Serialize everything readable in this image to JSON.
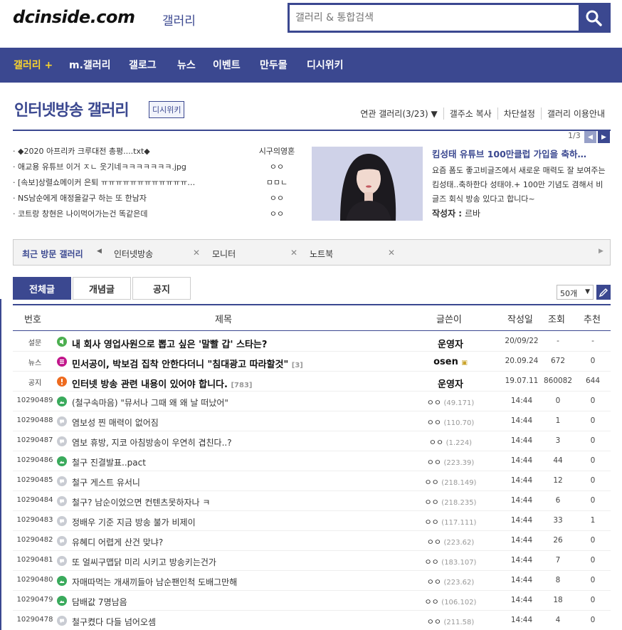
{
  "header": {
    "logo": "dcinside.com",
    "logo_sub": "갤러리",
    "search_placeholder": "갤러리 & 통합검색"
  },
  "nav": [
    "갤러리 +",
    "m.갤러리",
    "갤로그",
    "뉴스",
    "이벤트",
    "만두몰",
    "디시위키"
  ],
  "gallery": {
    "title": "인터넷방송 갤러리",
    "wiki_tag": "디시위키",
    "tools": [
      "연관 갤러리(3/23) ▼",
      "갤주소 복사",
      "차단설정",
      "갤러리 이용안내"
    ]
  },
  "concept_list": [
    {
      "title": "◆2020 아프리카 크루대전 총평....txt◆",
      "author": "시구의영혼"
    },
    {
      "title": "애교용 유튜브 이거 ㅈㄴ 웃기네ㅋㅋㅋㅋㅋㅋㅋ.jpg",
      "author": "ㅇㅇ"
    },
    {
      "title": "[속보]상렬쇼메이커 은퇴 ㅠㅠㅠㅠㅠㅠㅠㅠㅠㅠㅠㅠ…",
      "author": "ㅁㅁㄴ"
    },
    {
      "title": "NS남순에게 애정을갈구 하는 또 한남자",
      "author": "ㅇㅇ"
    },
    {
      "title": "코트랑 창현은 나이먹어가는건 똑같은데",
      "author": "ㅇㅇ"
    }
  ],
  "featured": {
    "pager": "1/3",
    "title": "킴성태 유튜브 100만클럽 가입을 축하…",
    "body": "요즘 폼도 좋고비글즈에서 새로운 매력도 잘 보여주는 킴성태..축하한다 성태야.+ 100만 기념도 겸해서 비글즈 회식 방송 있다고 합니다~",
    "writer_label": "작성자 :",
    "writer": "르바"
  },
  "recent": {
    "label": "최근 방문 갤러리",
    "items": [
      "인터넷방송",
      "모니터",
      "노트북"
    ]
  },
  "tabs": [
    "전체글",
    "개념글",
    "공지"
  ],
  "list_count": "50개",
  "table": {
    "headers": [
      "번호",
      "제목",
      "글쓴이",
      "작성일",
      "조회",
      "추천"
    ],
    "rows": [
      {
        "no": "설문",
        "icon": "survey",
        "title": "내 회사 영업사원으로 뽑고 싶은 '말빨 갑' 스타는?",
        "reply": "",
        "writer": "운영자",
        "ip": "",
        "date": "20/09/22",
        "views": "-",
        "rec": "-",
        "notice": true
      },
      {
        "no": "뉴스",
        "icon": "news",
        "title": "민서공이, 박보검 집착 안한다더니 \"침대광고 따라할것\"",
        "reply": "[3]",
        "writer": "osen",
        "ip": "",
        "date": "20.09.24",
        "views": "672",
        "rec": "0",
        "notice": true
      },
      {
        "no": "공지",
        "icon": "notice",
        "title": "인터넷 방송 관련 내용이 있어야 합니다.",
        "reply": "[783]",
        "writer": "운영자",
        "ip": "",
        "date": "19.07.11",
        "views": "860082",
        "rec": "644",
        "notice": true
      },
      {
        "no": "10290489",
        "icon": "image",
        "title": "(철구속마음) \"뮤서나 그때 왜 왜 날 떠났어\"",
        "reply": "",
        "writer": "ㅇㅇ",
        "ip": "(49.171)",
        "date": "14:44",
        "views": "0",
        "rec": "0"
      },
      {
        "no": "10290488",
        "icon": "text",
        "title": "염보성 찐 매력이 없어짐",
        "reply": "",
        "writer": "ㅇㅇ",
        "ip": "(110.70)",
        "date": "14:44",
        "views": "1",
        "rec": "0"
      },
      {
        "no": "10290487",
        "icon": "text",
        "title": "염보 휴방, 지코 아침방송이 우연히 겹친다..?",
        "reply": "",
        "writer": "ㅇㅇ",
        "ip": "(1.224)",
        "date": "14:44",
        "views": "3",
        "rec": "0"
      },
      {
        "no": "10290486",
        "icon": "image",
        "title": "철구 진결발표..pact",
        "reply": "",
        "writer": "ㅇㅇ",
        "ip": "(223.39)",
        "date": "14:44",
        "views": "44",
        "rec": "0"
      },
      {
        "no": "10290485",
        "icon": "text",
        "title": "철구 게스트 유서니",
        "reply": "",
        "writer": "ㅇㅇ",
        "ip": "(218.149)",
        "date": "14:44",
        "views": "12",
        "rec": "0"
      },
      {
        "no": "10290484",
        "icon": "text",
        "title": "철구? 남순이었으면 컨텐츠못하자나 ㅋ",
        "reply": "",
        "writer": "ㅇㅇ",
        "ip": "(218.235)",
        "date": "14:44",
        "views": "6",
        "rec": "0"
      },
      {
        "no": "10290483",
        "icon": "text",
        "title": "정배우 기준 지금 방송 불가 비제이",
        "reply": "",
        "writer": "ㅇㅇ",
        "ip": "(117.111)",
        "date": "14:44",
        "views": "33",
        "rec": "1"
      },
      {
        "no": "10290482",
        "icon": "text",
        "title": "유혜디 어렵게 산건 맞냐?",
        "reply": "",
        "writer": "ㅇㅇ",
        "ip": "(223.62)",
        "date": "14:44",
        "views": "26",
        "rec": "0"
      },
      {
        "no": "10290481",
        "icon": "text",
        "title": "또 얼씨구맵닭 미리 시키고 방송키는건가",
        "reply": "",
        "writer": "ㅇㅇ",
        "ip": "(183.107)",
        "date": "14:44",
        "views": "7",
        "rec": "0"
      },
      {
        "no": "10290480",
        "icon": "image",
        "title": "자매따먹는 개새끼들아 남순팬인척 도배그만해",
        "reply": "",
        "writer": "ㅇㅇ",
        "ip": "(223.62)",
        "date": "14:44",
        "views": "8",
        "rec": "0"
      },
      {
        "no": "10290479",
        "icon": "image",
        "title": "담배값 7명남음",
        "reply": "",
        "writer": "ㅇㅇ",
        "ip": "(106.102)",
        "date": "14:44",
        "views": "18",
        "rec": "0"
      },
      {
        "no": "10290478",
        "icon": "text",
        "title": "철구켰다 다들 넘어오셈",
        "reply": "",
        "writer": "ㅇㅇ",
        "ip": "(211.58)",
        "date": "14:44",
        "views": "4",
        "rec": "0"
      }
    ]
  },
  "colors": {
    "brand": "#3b4890",
    "nav_active": "#fbd52c"
  }
}
